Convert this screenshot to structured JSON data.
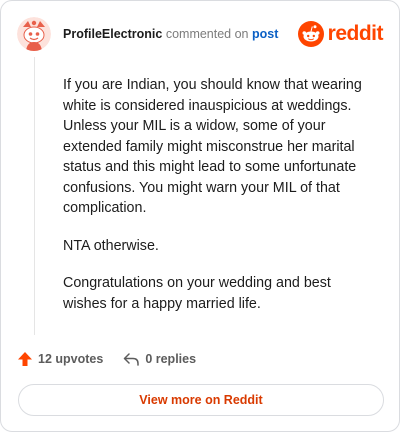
{
  "header": {
    "username": "ProfileElectronic",
    "action_text": "commented on",
    "post_link": "post",
    "logo_wordmark": "reddit"
  },
  "comment": {
    "paragraphs": [
      "If you are Indian, you should know that wearing white is considered inauspicious at weddings. Unless your MIL is a widow, some of your extended family might misconstrue her marital status and this might lead to some unfortunate confusions. You might warn your MIL of that complication.",
      "NTA otherwise.",
      "Congratulations on your wedding and best wishes for a happy married life."
    ]
  },
  "actions": {
    "upvotes": "12 upvotes",
    "replies": "0 replies"
  },
  "footer": {
    "view_more": "View more on Reddit"
  },
  "colors": {
    "brand": "#ff4500",
    "link": "#0b60c5",
    "button_text": "#d93a00"
  },
  "icons": {
    "avatar": "snoo-avatar-icon",
    "logo": "reddit-snoo-icon",
    "upvote": "upvote-arrow-icon",
    "reply": "reply-arrow-icon"
  }
}
